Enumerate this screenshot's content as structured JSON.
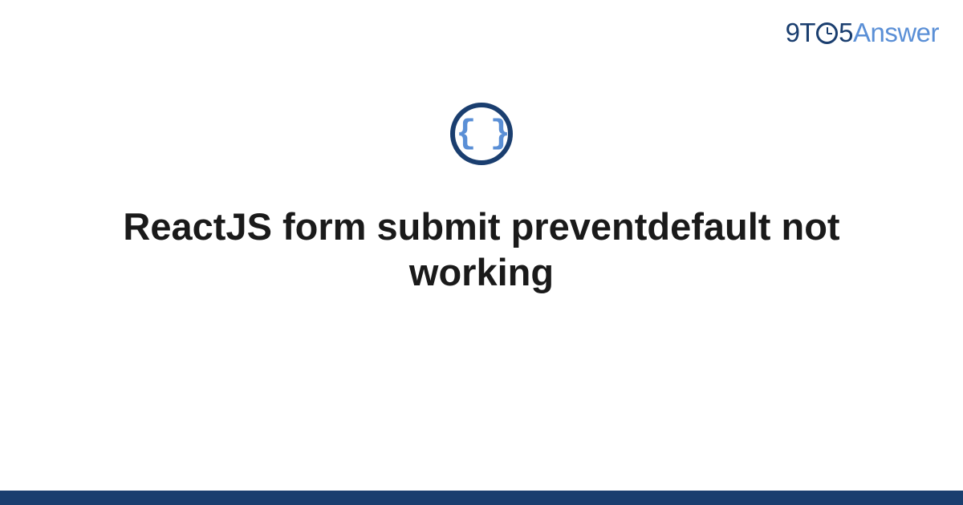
{
  "logo": {
    "part1": "9T",
    "part2": "5",
    "part3": "Answer"
  },
  "icon": {
    "braces": "{ }"
  },
  "title": "ReactJS form submit preventdefault not working",
  "colors": {
    "dark_blue": "#1a3e6f",
    "light_blue": "#5a8fd6"
  }
}
